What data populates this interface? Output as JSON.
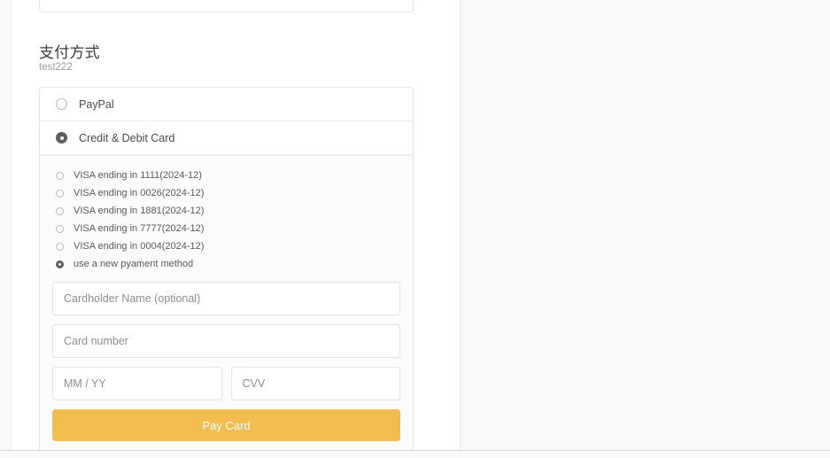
{
  "section": {
    "title": "支付方式",
    "subtitle": "test222"
  },
  "top_partial_card": {
    "text": "",
    "chevron": "⌄"
  },
  "methods": [
    {
      "label": "PayPal",
      "selected": false
    },
    {
      "label": "Credit & Debit Card",
      "selected": true
    }
  ],
  "saved_cards": [
    {
      "label": "VISA ending in 1111(2024-12)",
      "selected": false
    },
    {
      "label": "VISA ending in 0026(2024-12)",
      "selected": false
    },
    {
      "label": "VISA ending in 1881(2024-12)",
      "selected": false
    },
    {
      "label": "VISA ending in 7777(2024-12)",
      "selected": false
    },
    {
      "label": "VISA ending in 0004(2024-12)",
      "selected": false
    },
    {
      "label": "use a new pyament method",
      "selected": true
    }
  ],
  "form": {
    "cardholder_placeholder": "Cardholder Name (optional)",
    "cardholder_value": "",
    "card_number_placeholder": "Card number",
    "card_number_value": "",
    "expiry_placeholder": "MM / YY",
    "expiry_value": "",
    "cvv_placeholder": "CVV",
    "cvv_value": "",
    "pay_button_label": "Pay Card"
  },
  "colors": {
    "accent": "#f2bc4f",
    "radio_selected": "#5e5e5e",
    "panel_border": "#e6e6e6",
    "page_bg": "#f9f9f9"
  }
}
